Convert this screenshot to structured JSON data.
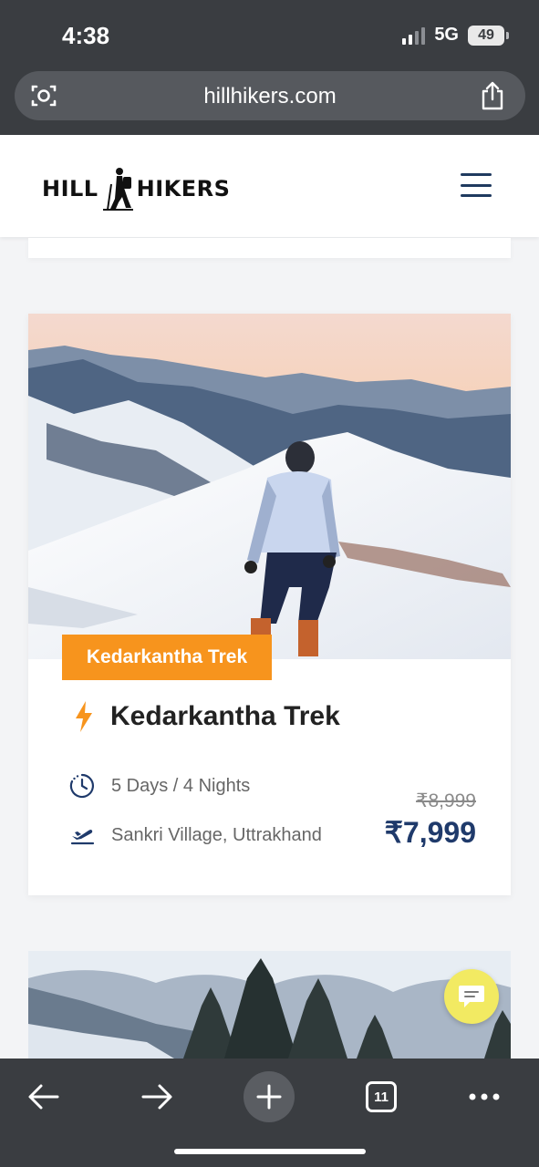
{
  "status_bar": {
    "time": "4:38",
    "network": "5G",
    "battery": "49"
  },
  "browser": {
    "url": "hillhikers.com",
    "lens_icon": "camera-search-icon",
    "share_icon": "share-icon",
    "tab_count": "11"
  },
  "site": {
    "logo_left": "HILL",
    "logo_right": "HIKERS",
    "menu_icon": "hamburger-menu-icon"
  },
  "card": {
    "tag": "Kedarkantha Trek",
    "title": "Kedarkantha Trek",
    "duration": "5 Days / 4 Nights",
    "location": "Sankri Village, Uttrakhand",
    "old_price": "₹8,999",
    "price": "₹7,999"
  },
  "colors": {
    "accent_orange": "#f7941d",
    "price_blue": "#1f3a6b",
    "chrome_dark": "#3a3d41",
    "chat_yellow": "#f2ea62"
  }
}
